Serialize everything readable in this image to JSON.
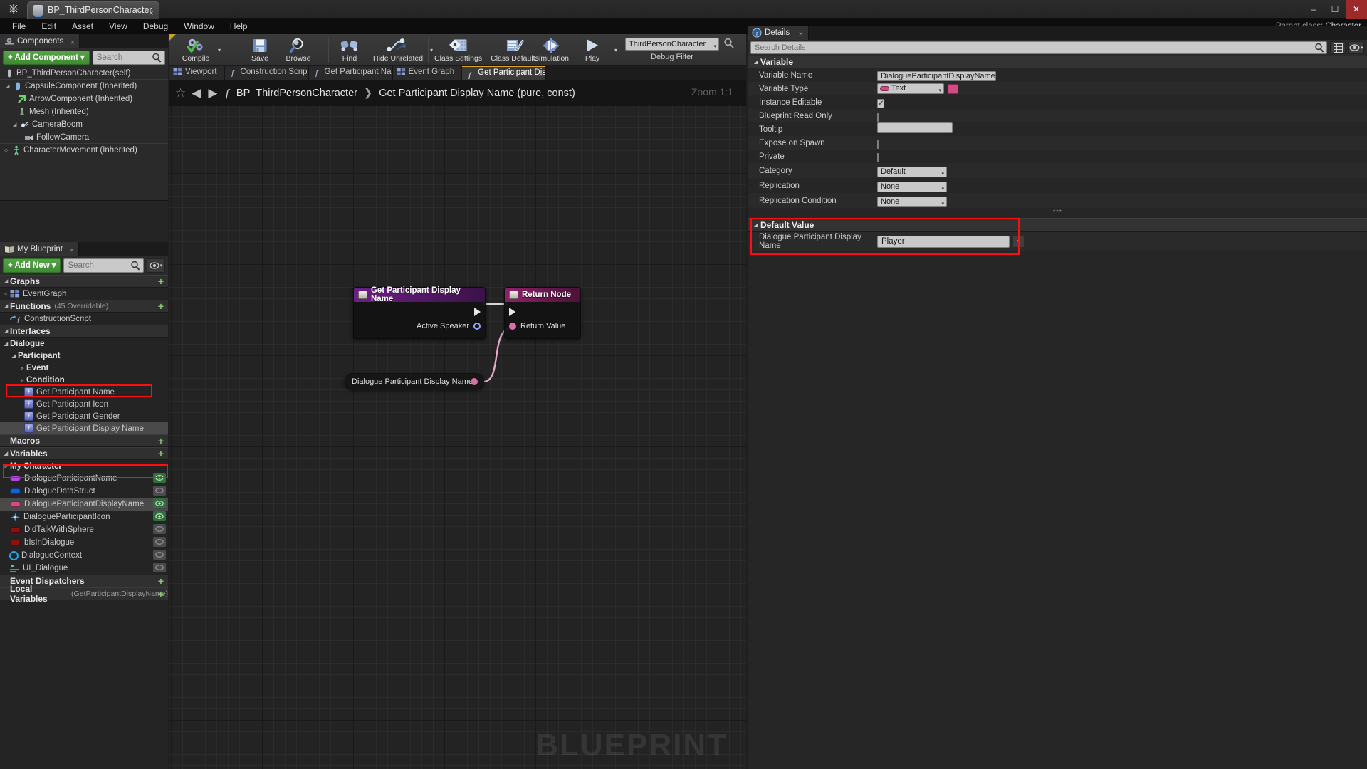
{
  "window": {
    "tab_title": "BP_ThirdPersonCharacter",
    "tab_close": "×",
    "minimize": "–",
    "maximize": "☐",
    "close": "✕",
    "parent_class_label": "Parent class:",
    "parent_class_value": "Character"
  },
  "menu": [
    "File",
    "Edit",
    "Asset",
    "View",
    "Debug",
    "Window",
    "Help"
  ],
  "components_panel": {
    "tab_label": "Components",
    "tab_close": "×",
    "add_component_label": "+ Add Component",
    "add_component_caret": "▾",
    "search_placeholder": "Search",
    "items": [
      {
        "label": "BP_ThirdPersonCharacter(self)",
        "indent": 0,
        "arrow": "",
        "icon": "pawn-icon"
      },
      {
        "label": "CapsuleComponent (Inherited)",
        "indent": 1,
        "arrow": "◢",
        "icon": "capsule-icon"
      },
      {
        "label": "ArrowComponent (Inherited)",
        "indent": 2,
        "arrow": "",
        "icon": "arrow-icon"
      },
      {
        "label": "Mesh (Inherited)",
        "indent": 2,
        "arrow": "",
        "icon": "mesh-icon"
      },
      {
        "label": "CameraBoom",
        "indent": 1,
        "arrow": "◢",
        "icon": "spring-arm-icon"
      },
      {
        "label": "FollowCamera",
        "indent": 2,
        "arrow": "",
        "icon": "camera-icon"
      },
      {
        "label": "CharacterMovement (Inherited)",
        "indent": 0,
        "arrow": "◇",
        "icon": "character-movement-icon"
      }
    ]
  },
  "my_blueprint": {
    "tab_label": "My Blueprint",
    "tab_close": "×",
    "add_new_label": "+ Add New",
    "add_new_caret": "▾",
    "search_placeholder": "Search",
    "sections": {
      "graphs": "Graphs",
      "functions": "Functions",
      "functions_sub": "(45 Overridable)",
      "interfaces": "Interfaces",
      "macros": "Macros",
      "variables": "Variables",
      "event_dispatchers": "Event Dispatchers",
      "local_variables": "Local Variables",
      "local_variables_sub": "(GetParticipantDisplayName)",
      "plus": "+"
    },
    "graphs_items": [
      {
        "label": "EventGraph",
        "arrow": "▹"
      }
    ],
    "functions_items": [
      {
        "label": "ConstructionScript"
      }
    ],
    "interfaces_tree": [
      {
        "label": "Dialogue",
        "indent": 0,
        "arrow": "◢",
        "bold": true
      },
      {
        "label": "Participant",
        "indent": 1,
        "arrow": "◢",
        "bold": true
      },
      {
        "label": "Event",
        "indent": 2,
        "arrow": "▹",
        "bold": true
      },
      {
        "label": "Condition",
        "indent": 2,
        "arrow": "▹",
        "bold": true
      },
      {
        "label": "Get Participant Name",
        "indent": 3,
        "arrow": "",
        "func": true
      },
      {
        "label": "Get Participant Icon",
        "indent": 3,
        "arrow": "",
        "func": true
      },
      {
        "label": "Get Participant Gender",
        "indent": 3,
        "arrow": "",
        "func": true
      },
      {
        "label": "Get Participant Display Name",
        "indent": 3,
        "arrow": "",
        "func": true,
        "highlighted": true
      }
    ],
    "variables_group": {
      "label": "My Character",
      "arrow": "▹"
    },
    "variables": [
      {
        "label": "DialogueParticipantName",
        "color": "#b44ad8",
        "shape": "pill",
        "eye": true
      },
      {
        "label": "DialogueDataStruct",
        "color": "#1a5fd4",
        "shape": "pill",
        "eye": false
      },
      {
        "label": "DialogueParticipantDisplayName",
        "color": "#d64a84",
        "shape": "pill",
        "eye": true,
        "selected": true
      },
      {
        "label": "DialogueParticipantIcon",
        "color": "#2f7fd4",
        "shape": "star",
        "eye": true
      },
      {
        "label": "DidTalkWithSphere",
        "color": "#8c1212",
        "shape": "pill",
        "eye": false
      },
      {
        "label": "bIsInDialogue",
        "color": "#8c1212",
        "shape": "pill",
        "eye": false
      },
      {
        "label": "DialogueContext",
        "color": "#22a6e8",
        "shape": "circle",
        "eye": false
      },
      {
        "label": "UI_Dialogue",
        "color": "#2f7fd4",
        "shape": "widget",
        "eye": false
      }
    ]
  },
  "toolbar": {
    "buttons": [
      {
        "label": "Compile",
        "icon": "compile-icon",
        "caret": true
      },
      {
        "label": "Save",
        "icon": "save-icon",
        "caret": false
      },
      {
        "label": "Browse",
        "icon": "browse-icon",
        "caret": false
      },
      {
        "label": "Find",
        "icon": "find-icon",
        "caret": false
      },
      {
        "label": "Hide Unrelated",
        "icon": "hide-unrelated-icon",
        "caret": true
      },
      {
        "label": "Class Settings",
        "icon": "class-settings-icon",
        "caret": false
      },
      {
        "label": "Class Defaults",
        "icon": "class-defaults-icon",
        "caret": false
      },
      {
        "label": "Simulation",
        "icon": "simulation-icon",
        "caret": false
      },
      {
        "label": "Play",
        "icon": "play-icon",
        "caret": true
      }
    ],
    "debug_filter_value": "ThirdPersonCharacter",
    "debug_filter_caret": "▾",
    "debug_filter_label": "Debug Filter"
  },
  "graph_tabs": [
    {
      "label": "Viewport",
      "icon": "viewport-icon",
      "active": false,
      "close": false
    },
    {
      "label": "Construction Scrip",
      "icon": "function-icon",
      "active": false,
      "close": false
    },
    {
      "label": "Get Participant Na",
      "icon": "function-icon",
      "active": false,
      "close": false
    },
    {
      "label": "Event Graph",
      "icon": "event-graph-icon",
      "active": false,
      "close": false
    },
    {
      "label": "Get Participant Dis",
      "icon": "function-icon",
      "active": true,
      "close": true,
      "close_glyph": "×"
    }
  ],
  "graph": {
    "star": "☆",
    "back_arrow": "◀",
    "forward_arrow": "▶",
    "fx": "ƒ",
    "breadcrumb_root": "BP_ThirdPersonCharacter",
    "breadcrumb_sep": "❯",
    "breadcrumb_current": "Get Participant Display Name (pure, const)",
    "zoom_label": "Zoom 1:1",
    "watermark": "BLUEPRINT",
    "nodes": [
      {
        "title": "Get Participant Display Name",
        "header_style": "purple",
        "pins": [
          {
            "label": "",
            "type": "exec-out"
          },
          {
            "label": "Active Speaker",
            "type": "object-out"
          }
        ]
      },
      {
        "title": "Return Node",
        "header_style": "pinkish",
        "pins": [
          {
            "label": "",
            "type": "exec-in"
          },
          {
            "label": "Return Value",
            "type": "text-in"
          }
        ]
      }
    ],
    "var_node_label": "Dialogue Participant Display Name"
  },
  "details": {
    "tab_label": "Details",
    "tab_close": "×",
    "search_placeholder": "Search Details",
    "category_variable": "Variable",
    "properties": [
      {
        "label": "Variable Name",
        "kind": "text",
        "value": "DialogueParticipantDisplayName"
      },
      {
        "label": "Variable Type",
        "kind": "type",
        "value": "Text"
      },
      {
        "label": "Instance Editable",
        "kind": "checkbox",
        "checked": true,
        "check_glyph": "✔"
      },
      {
        "label": "Blueprint Read Only",
        "kind": "checkbox",
        "checked": false
      },
      {
        "label": "Tooltip",
        "kind": "input",
        "value": ""
      },
      {
        "label": "Expose on Spawn",
        "kind": "checkbox",
        "checked": false
      },
      {
        "label": "Private",
        "kind": "checkbox",
        "checked": false
      },
      {
        "label": "Category",
        "kind": "select",
        "value": "Default",
        "caret": "▾"
      },
      {
        "label": "Replication",
        "kind": "select",
        "value": "None",
        "caret": "▾"
      },
      {
        "label": "Replication Condition",
        "kind": "select",
        "value": "None",
        "caret": "▾"
      }
    ],
    "default_value": {
      "category": "Default Value",
      "label": "Dialogue Participant Display Name",
      "value": "Player",
      "caret": "▾"
    }
  }
}
